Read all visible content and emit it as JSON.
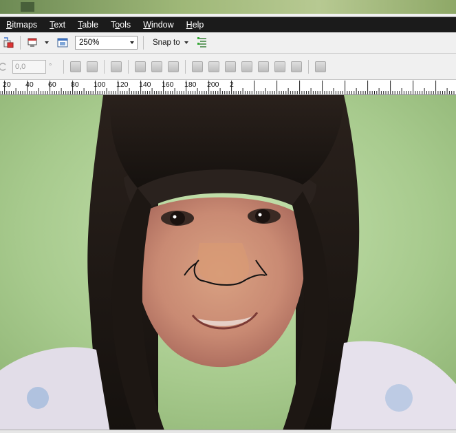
{
  "menubar": {
    "items": [
      {
        "label": "Bitmaps",
        "underline": "B"
      },
      {
        "label": "Text",
        "underline": "T"
      },
      {
        "label": "Table",
        "underline": "T"
      },
      {
        "label": "Tools",
        "underline": "o"
      },
      {
        "label": "Window",
        "underline": "W"
      },
      {
        "label": "Help",
        "underline": "H"
      }
    ]
  },
  "toolbar": {
    "zoom_value": "250%",
    "snap_label": "Snap to",
    "icons": [
      "import-icon",
      "publish-icon",
      "application-launcher-icon",
      "snap-options-icon"
    ]
  },
  "property_bar": {
    "rotation_value": "0,0",
    "degree_symbol": "°"
  },
  "ruler": {
    "labels": [
      "20",
      "40",
      "60",
      "80",
      "100",
      "120",
      "140",
      "160",
      "180",
      "200",
      "2"
    ]
  },
  "canvas": {
    "background_color": "#a9c98e",
    "nose_stroke_color": "#111111"
  }
}
